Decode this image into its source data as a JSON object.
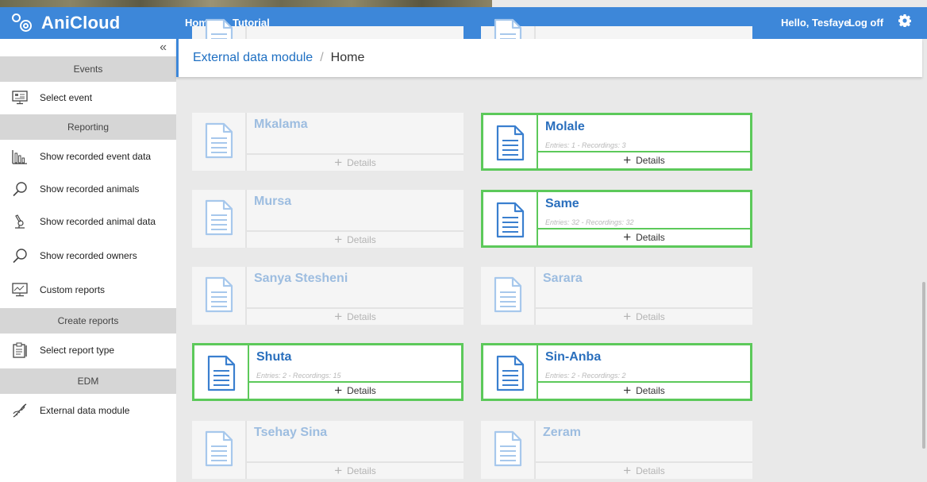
{
  "app": {
    "name": "AniCloud"
  },
  "navbar": {
    "links": [
      "Home",
      "Tutorial"
    ],
    "greeting": "Hello, Tesfaye",
    "logoff": "Log off"
  },
  "sidebar": {
    "collapse": "«",
    "sections": [
      {
        "title": "Events",
        "items": [
          {
            "label": "Select event",
            "icon": "monitor-icon"
          }
        ]
      },
      {
        "title": "Reporting",
        "items": [
          {
            "label": "Show recorded event data",
            "icon": "bar-chart-icon"
          },
          {
            "label": "Show recorded animals",
            "icon": "search-icon"
          },
          {
            "label": "Show recorded animal data",
            "icon": "microscope-icon"
          },
          {
            "label": "Show recorded owners",
            "icon": "search-icon"
          },
          {
            "label": "Custom reports",
            "icon": "report-screen-icon"
          }
        ]
      },
      {
        "title": "Create reports",
        "items": [
          {
            "label": "Select report type",
            "icon": "clipboard-icon"
          }
        ]
      },
      {
        "title": "EDM",
        "items": [
          {
            "label": "External data module",
            "icon": "dna-icon"
          }
        ]
      }
    ]
  },
  "breadcrumb": {
    "parent": "External data module",
    "separator": "/",
    "current": "Home"
  },
  "cards": {
    "details_label": "Details",
    "items": [
      {
        "name": "",
        "stats": "",
        "active": false
      },
      {
        "name": "",
        "stats": "",
        "active": false
      },
      {
        "name": "Mkalama",
        "stats": "",
        "active": false
      },
      {
        "name": "Molale",
        "stats": "Entries: 1 - Recordings: 3",
        "active": true
      },
      {
        "name": "Mursa",
        "stats": "",
        "active": false
      },
      {
        "name": "Same",
        "stats": "Entries: 32 - Recordings: 32",
        "active": true
      },
      {
        "name": "Sanya Stesheni",
        "stats": "",
        "active": false
      },
      {
        "name": "Sarara",
        "stats": "",
        "active": false
      },
      {
        "name": "Shuta",
        "stats": "Entries: 2 - Recordings: 15",
        "active": true
      },
      {
        "name": "Sin-Anba",
        "stats": "Entries: 2 - Recordings: 2",
        "active": true
      },
      {
        "name": "Tsehay Sina",
        "stats": "",
        "active": false
      },
      {
        "name": "Zeram",
        "stats": "",
        "active": false
      }
    ]
  },
  "colors": {
    "accent": "#3d87d9",
    "active_border": "#5cc95a",
    "inactive_name": "#9dbde0",
    "active_name": "#2a6fbd"
  }
}
